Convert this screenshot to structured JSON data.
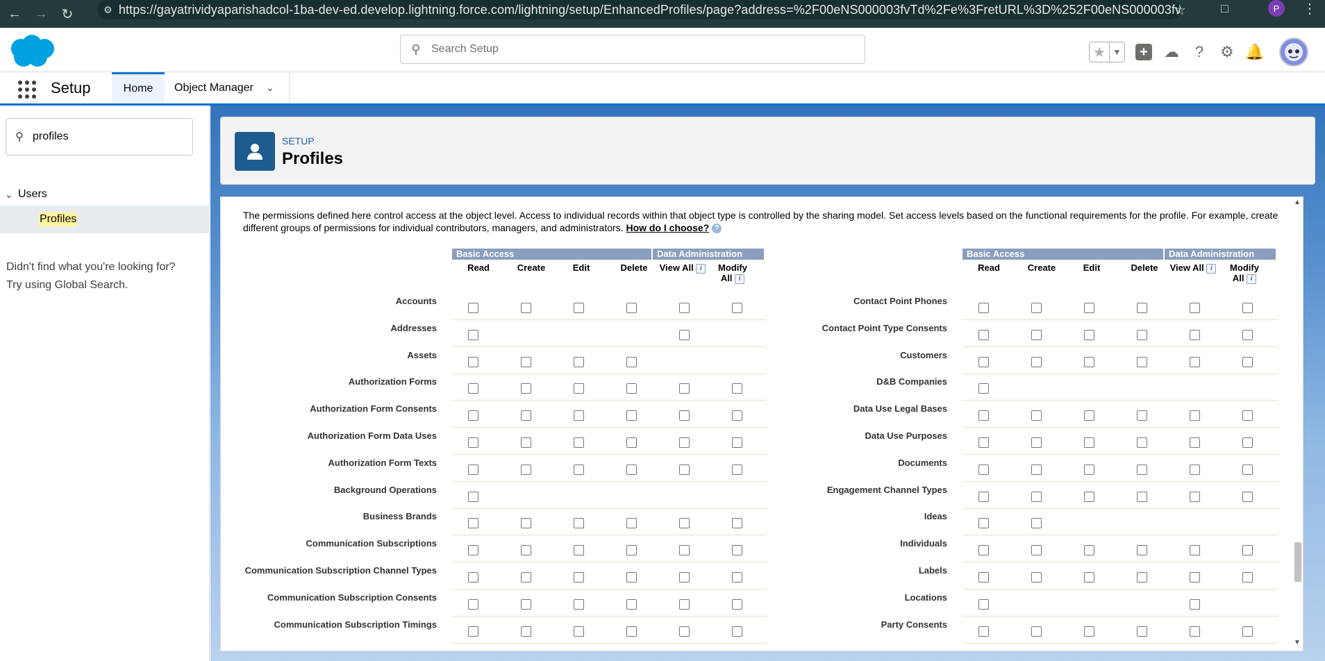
{
  "browser": {
    "url": "https://gayatrividyaparishadcol-1ba-dev-ed.develop.lightning.force.com/lightning/setup/EnhancedProfiles/page?address=%2F00eNS000003fvTd%2Fe%3FretURL%3D%252F00eNS000003fvTd%...",
    "profile_initial": "P"
  },
  "header": {
    "search_placeholder": "Search Setup"
  },
  "nav": {
    "app_name": "Setup",
    "tab_home": "Home",
    "tab_object_manager": "Object Manager"
  },
  "sidebar": {
    "quickfind_value": "profiles",
    "tree_users": "Users",
    "tree_profiles": "Profiles",
    "notfound_line1": "Didn't find what you're looking for?",
    "notfound_line2": "Try using Global Search."
  },
  "page": {
    "eyebrow": "SETUP",
    "title": "Profiles",
    "description": "The permissions defined here control access at the object level. Access to individual records within that object type is controlled by the sharing model. Set access levels based on the functional requirements for the profile. For example, create different groups of permissions for individual contributors, managers, and administrators.",
    "how_link": "How do I choose?"
  },
  "table": {
    "group_basic": "Basic Access",
    "group_admin": "Data Administration",
    "col_read": "Read",
    "col_create": "Create",
    "col_edit": "Edit",
    "col_delete": "Delete",
    "col_viewall": "View All",
    "col_modifyall": "Modify All",
    "left_rows": [
      {
        "label": "Accounts",
        "cols": [
          1,
          1,
          1,
          1,
          1,
          1
        ]
      },
      {
        "label": "Addresses",
        "cols": [
          1,
          0,
          0,
          0,
          1,
          0
        ]
      },
      {
        "label": "Assets",
        "cols": [
          1,
          1,
          1,
          1,
          0,
          0
        ]
      },
      {
        "label": "Authorization Forms",
        "cols": [
          1,
          1,
          1,
          1,
          1,
          1
        ]
      },
      {
        "label": "Authorization Form Consents",
        "cols": [
          1,
          1,
          1,
          1,
          1,
          1
        ]
      },
      {
        "label": "Authorization Form Data Uses",
        "cols": [
          1,
          1,
          1,
          1,
          1,
          1
        ]
      },
      {
        "label": "Authorization Form Texts",
        "cols": [
          1,
          1,
          1,
          1,
          1,
          1
        ]
      },
      {
        "label": "Background Operations",
        "cols": [
          1,
          0,
          0,
          0,
          0,
          0
        ]
      },
      {
        "label": "Business Brands",
        "cols": [
          1,
          1,
          1,
          1,
          1,
          1
        ]
      },
      {
        "label": "Communication Subscriptions",
        "cols": [
          1,
          1,
          1,
          1,
          1,
          1
        ]
      },
      {
        "label": "Communication Subscription Channel Types",
        "cols": [
          1,
          1,
          1,
          1,
          1,
          1
        ]
      },
      {
        "label": "Communication Subscription Consents",
        "cols": [
          1,
          1,
          1,
          1,
          1,
          1
        ]
      },
      {
        "label": "Communication Subscription Timings",
        "cols": [
          1,
          1,
          1,
          1,
          1,
          1
        ]
      }
    ],
    "right_rows": [
      {
        "label": "Contact Point Phones",
        "cols": [
          1,
          1,
          1,
          1,
          1,
          1
        ]
      },
      {
        "label": "Contact Point Type Consents",
        "cols": [
          1,
          1,
          1,
          1,
          1,
          1
        ]
      },
      {
        "label": "Customers",
        "cols": [
          1,
          1,
          1,
          1,
          1,
          1
        ]
      },
      {
        "label": "D&B Companies",
        "cols": [
          1,
          0,
          0,
          0,
          0,
          0
        ]
      },
      {
        "label": "Data Use Legal Bases",
        "cols": [
          1,
          1,
          1,
          1,
          1,
          1
        ]
      },
      {
        "label": "Data Use Purposes",
        "cols": [
          1,
          1,
          1,
          1,
          1,
          1
        ]
      },
      {
        "label": "Documents",
        "cols": [
          1,
          1,
          1,
          1,
          1,
          1
        ]
      },
      {
        "label": "Engagement Channel Types",
        "cols": [
          1,
          1,
          1,
          1,
          1,
          1
        ]
      },
      {
        "label": "Ideas",
        "cols": [
          1,
          1,
          0,
          0,
          0,
          0
        ]
      },
      {
        "label": "Individuals",
        "cols": [
          1,
          1,
          1,
          1,
          1,
          1
        ]
      },
      {
        "label": "Labels",
        "cols": [
          1,
          1,
          1,
          1,
          1,
          1
        ]
      },
      {
        "label": "Locations",
        "cols": [
          1,
          0,
          0,
          0,
          1,
          0
        ]
      },
      {
        "label": "Party Consents",
        "cols": [
          1,
          1,
          1,
          1,
          1,
          1
        ]
      }
    ]
  },
  "colors": {
    "brand_blue": "#0176d3",
    "group_header": "#8a9ebe",
    "browser_bar": "#233b3a"
  }
}
